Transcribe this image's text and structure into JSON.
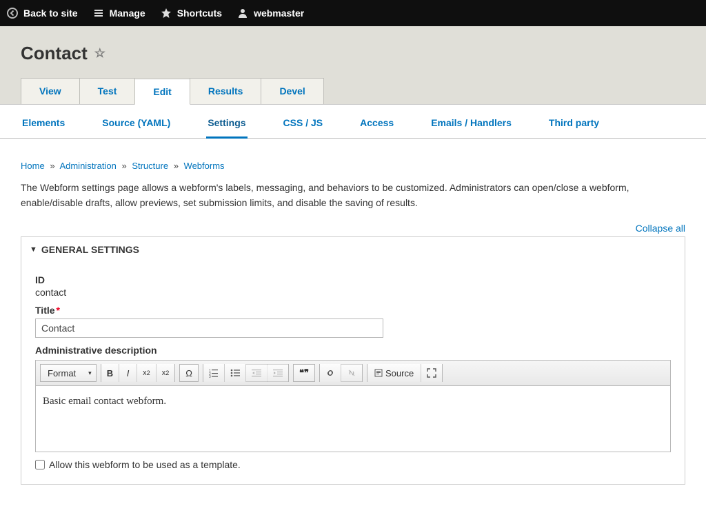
{
  "toolbar": {
    "back": "Back to site",
    "manage": "Manage",
    "shortcuts": "Shortcuts",
    "user": "webmaster"
  },
  "page": {
    "title": "Contact"
  },
  "primary_tabs": {
    "view": "View",
    "test": "Test",
    "edit": "Edit",
    "results": "Results",
    "devel": "Devel"
  },
  "secondary_tabs": {
    "elements": "Elements",
    "source": "Source (YAML)",
    "settings": "Settings",
    "cssjs": "CSS / JS",
    "access": "Access",
    "emails": "Emails / Handlers",
    "third": "Third party"
  },
  "breadcrumbs": {
    "home": "Home",
    "admin": "Administration",
    "structure": "Structure",
    "webforms": "Webforms"
  },
  "help_text": "The Webform settings page allows a webform's labels, messaging, and behaviors to be customized. Administrators can open/close a webform, enable/disable drafts, allow previews, set submission limits, and disable the saving of results.",
  "collapse_all": "Collapse all",
  "panel": {
    "title": "General Settings",
    "id_label": "ID",
    "id_value": "contact",
    "title_label": "Title",
    "title_value": "Contact",
    "admin_desc_label": "Administrative description",
    "admin_desc_value": "Basic email contact webform.",
    "template_checkbox": "Allow this webform to be used as a template."
  },
  "ck": {
    "format": "Format",
    "source": "Source"
  }
}
